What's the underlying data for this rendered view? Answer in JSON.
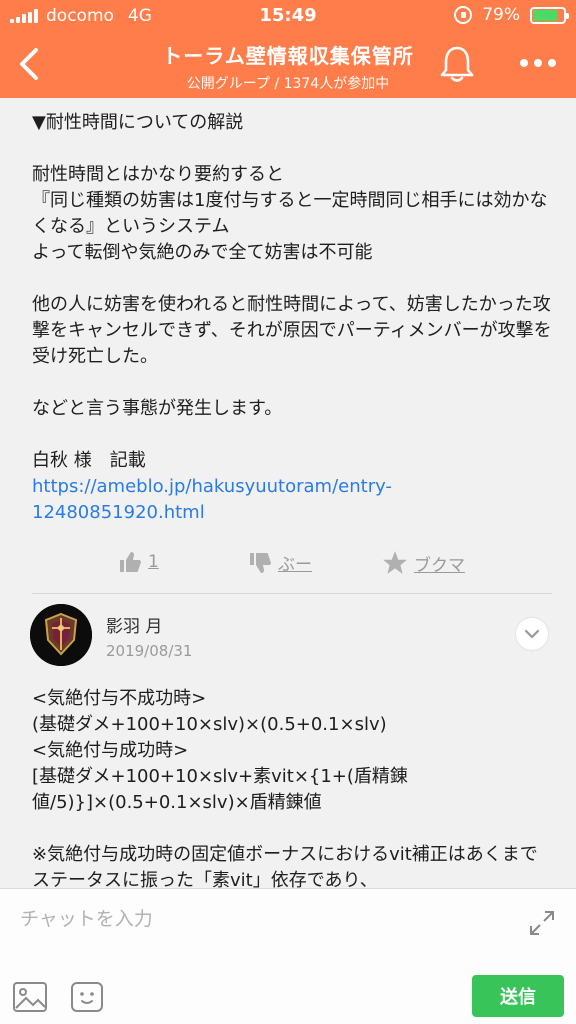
{
  "status_bar": {
    "carrier": "docomo",
    "network": "4G",
    "time": "15:49",
    "battery_percent": "79%",
    "battery_level": 0.79
  },
  "header": {
    "title": "トーラム壁情報収集保管所",
    "subtitle": "公開グループ / 1374人が参加中",
    "accent_color": "#ff7d4a"
  },
  "message": {
    "text": "▼耐性時間についての解説\n\n耐性時間とはかなり要約すると\n『同じ種類の妨害は1度付与すると一定時間同じ相手には効かなくなる』というシステム\nよって転倒や気絶のみで全て妨害は不可能\n\n他の人に妨害を使われると耐性時間によって、妨害したかった攻撃をキャンセルできず、それが原因でパーティメンバーが攻撃を受け死亡した。\n\nなどと言う事態が発生します。\n\n白秋 様　記載",
    "link": "https://ameblo.jp/hakusyuutoram/entry-12480851920.html"
  },
  "reactions": {
    "like_count": "1",
    "boo_label": "ぶー",
    "bookmark_label": "ブクマ"
  },
  "comment": {
    "author": "影羽 月",
    "date": "2019/08/31",
    "body": "<気絶付与不成功時>\n(基礎ダメ+100+10×slv)×(0.5+0.1×slv)\n<気絶付与成功時>\n[基礎ダメ+100+10×slv+素vit×{1+(盾精錬値/5)}]×(0.5+0.1×slv)×盾精錬値\n\n※気絶付与成功時の固定値ボーナスにおけるvit補正はあくまでステータスに振った「素vit」依存であり、"
  },
  "input_bar": {
    "placeholder": "チャットを入力",
    "send_label": "送信",
    "send_color": "#39c45a"
  },
  "icons": [
    "back-icon",
    "bell-icon",
    "more-icon",
    "thumbs-up-icon",
    "thumbs-down-icon",
    "star-icon",
    "chevron-down-icon",
    "expand-icon",
    "image-icon",
    "sticker-icon"
  ]
}
